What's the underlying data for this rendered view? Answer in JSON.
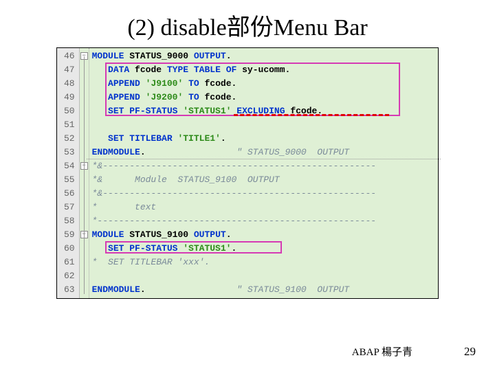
{
  "slide": {
    "title": "(2) disable部份Menu Bar",
    "footer_author": "ABAP 楊子青",
    "footer_page": "29"
  },
  "code": {
    "first_line": 46,
    "lines": [
      {
        "n": 46,
        "fold": "open",
        "seg": [
          [
            "kw",
            "MODULE"
          ],
          [
            "txt",
            " "
          ],
          [
            "nm",
            "STATUS_9000"
          ],
          [
            "txt",
            " "
          ],
          [
            "kw",
            "OUTPUT"
          ],
          [
            "punc",
            "."
          ]
        ]
      },
      {
        "n": 47,
        "seg": [
          [
            "txt",
            "   "
          ],
          [
            "kw",
            "DATA"
          ],
          [
            "txt",
            " "
          ],
          [
            "nm",
            "fcode"
          ],
          [
            "txt",
            " "
          ],
          [
            "kw",
            "TYPE TABLE OF"
          ],
          [
            "txt",
            " "
          ],
          [
            "nm",
            "sy-ucomm"
          ],
          [
            "punc",
            "."
          ]
        ]
      },
      {
        "n": 48,
        "seg": [
          [
            "txt",
            "   "
          ],
          [
            "kw",
            "APPEND"
          ],
          [
            "txt",
            " "
          ],
          [
            "str",
            "'J9100'"
          ],
          [
            "txt",
            " "
          ],
          [
            "kw",
            "TO"
          ],
          [
            "txt",
            " "
          ],
          [
            "nm",
            "fcode"
          ],
          [
            "punc",
            "."
          ]
        ]
      },
      {
        "n": 49,
        "seg": [
          [
            "txt",
            "   "
          ],
          [
            "kw",
            "APPEND"
          ],
          [
            "txt",
            " "
          ],
          [
            "str",
            "'J9200'"
          ],
          [
            "txt",
            " "
          ],
          [
            "kw",
            "TO"
          ],
          [
            "txt",
            " "
          ],
          [
            "nm",
            "fcode"
          ],
          [
            "punc",
            "."
          ]
        ]
      },
      {
        "n": 50,
        "seg": [
          [
            "txt",
            "   "
          ],
          [
            "kw",
            "SET PF-STATUS"
          ],
          [
            "txt",
            " "
          ],
          [
            "str",
            "'STATUS1'"
          ],
          [
            "txt",
            " "
          ],
          [
            "kw",
            "EXCLUDING"
          ],
          [
            "txt",
            " "
          ],
          [
            "nm",
            "fcode"
          ],
          [
            "punc",
            "."
          ]
        ]
      },
      {
        "n": 51,
        "seg": []
      },
      {
        "n": 52,
        "seg": [
          [
            "txt",
            "   "
          ],
          [
            "kw",
            "SET TITLEBAR"
          ],
          [
            "txt",
            " "
          ],
          [
            "str",
            "'TITLE1'"
          ],
          [
            "punc",
            "."
          ]
        ]
      },
      {
        "n": 53,
        "seg": [
          [
            "kw",
            "ENDMODULE"
          ],
          [
            "punc",
            "."
          ],
          [
            "txt",
            "                 "
          ],
          [
            "cmt",
            "\" STATUS_9000  OUTPUT"
          ]
        ]
      },
      {
        "n": 54,
        "fold": "open",
        "seg": [
          [
            "cmt",
            "*&---------------------------------------------------"
          ]
        ]
      },
      {
        "n": 55,
        "seg": [
          [
            "cmt",
            "*&      Module  STATUS_9100  OUTPUT"
          ]
        ]
      },
      {
        "n": 56,
        "seg": [
          [
            "cmt",
            "*&---------------------------------------------------"
          ]
        ]
      },
      {
        "n": 57,
        "seg": [
          [
            "cmt",
            "*       text"
          ]
        ]
      },
      {
        "n": 58,
        "seg": [
          [
            "cmt",
            "*----------------------------------------------------"
          ]
        ]
      },
      {
        "n": 59,
        "fold": "open",
        "seg": [
          [
            "kw",
            "MODULE"
          ],
          [
            "txt",
            " "
          ],
          [
            "nm",
            "STATUS_9100"
          ],
          [
            "txt",
            " "
          ],
          [
            "kw",
            "OUTPUT"
          ],
          [
            "punc",
            "."
          ]
        ]
      },
      {
        "n": 60,
        "seg": [
          [
            "txt",
            "   "
          ],
          [
            "kw",
            "SET PF-STATUS"
          ],
          [
            "txt",
            " "
          ],
          [
            "str",
            "'STATUS1'"
          ],
          [
            "punc",
            "."
          ]
        ]
      },
      {
        "n": 61,
        "seg": [
          [
            "cmt",
            "*  SET TITLEBAR 'xxx'."
          ]
        ]
      },
      {
        "n": 62,
        "seg": []
      },
      {
        "n": 63,
        "seg": [
          [
            "kw",
            "ENDMODULE"
          ],
          [
            "punc",
            "."
          ],
          [
            "txt",
            "                 "
          ],
          [
            "cmt",
            "\" STATUS_9100  OUTPUT"
          ]
        ]
      }
    ],
    "highlights": [
      {
        "top_line": 47,
        "bottom_line": 50,
        "left_ch": 3,
        "right_ch": 58
      },
      {
        "top_line": 60,
        "bottom_line": 60,
        "left_ch": 3,
        "right_ch": 36
      }
    ],
    "red_dash": {
      "line": 50,
      "left_ch": 27,
      "right_ch": 56
    }
  }
}
